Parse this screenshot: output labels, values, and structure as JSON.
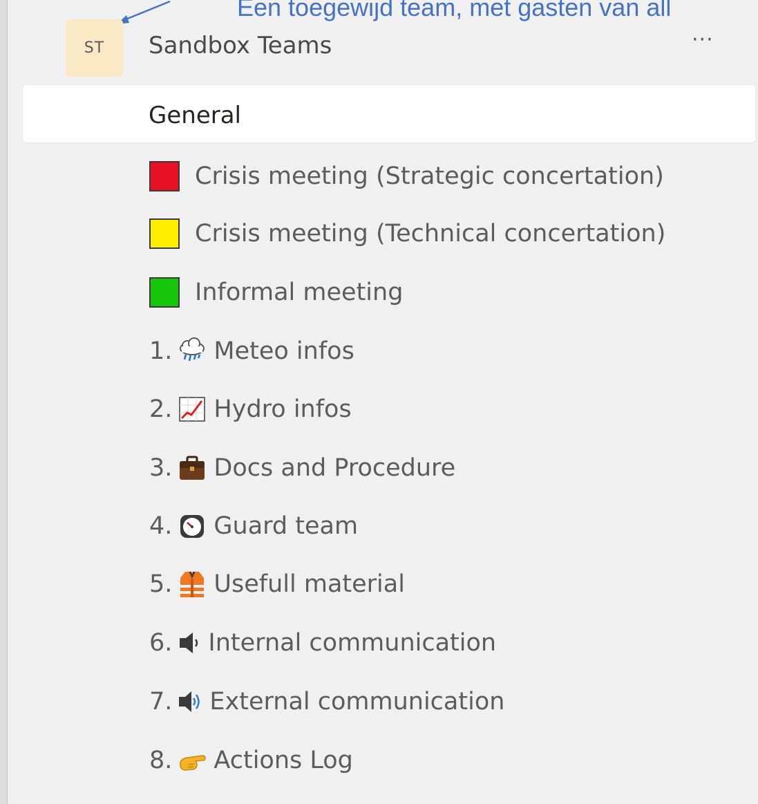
{
  "annotation": "Een toegewijd team, met gasten van all",
  "team": {
    "initials": "ST",
    "name": "Sandbox Teams",
    "more": "···"
  },
  "general": "General",
  "colors": {
    "red": "#e81123",
    "yellow": "#ffee00",
    "green": "#16c60c",
    "accent": "#4472c4"
  },
  "channels": [
    {
      "label": "Crisis meeting (Strategic concertation)",
      "icon": "red-square"
    },
    {
      "label": "Crisis meeting (Technical concertation)",
      "icon": "yellow-square"
    },
    {
      "label": "Informal meeting",
      "icon": "green-square"
    },
    {
      "num": "1.",
      "label": "Meteo infos",
      "icon": "rain-cloud-icon"
    },
    {
      "num": "2.",
      "label": "Hydro infos",
      "icon": "chart-increasing-icon"
    },
    {
      "num": "3.",
      "label": "Docs and Procedure",
      "icon": "briefcase-icon"
    },
    {
      "num": "4.",
      "label": "Guard team",
      "icon": "stopwatch-icon"
    },
    {
      "num": "5.",
      "label": "Usefull material",
      "icon": "safety-vest-icon"
    },
    {
      "num": "6.",
      "label": "Internal communication",
      "icon": "speaker-low-icon"
    },
    {
      "num": "7.",
      "label": "External communication",
      "icon": "speaker-high-icon"
    },
    {
      "num": "8.",
      "label": "Actions Log",
      "icon": "pointing-hand-icon"
    }
  ]
}
